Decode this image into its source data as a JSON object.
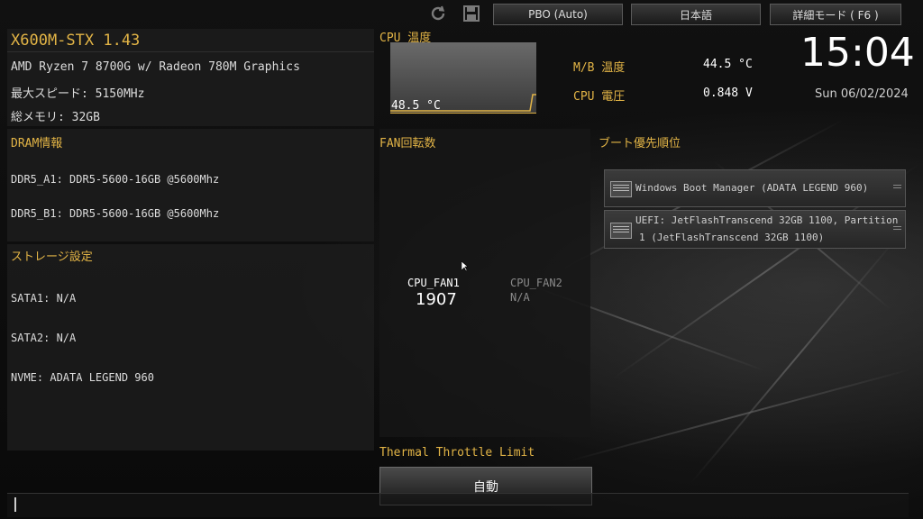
{
  "toolbar": {
    "pbo_label": "PBO (Auto)",
    "language_label": "日本語",
    "advanced_label": "詳細モード ( F6 )"
  },
  "system": {
    "model": "X600M-STX 1.43",
    "cpu": "AMD Ryzen 7 8700G w/ Radeon 780M Graphics",
    "max_speed": "最大スピード: 5150MHz",
    "total_memory": "総メモリ: 32GB"
  },
  "cpu_temp": {
    "title": "CPU 温度",
    "value": "48.5 °C"
  },
  "sensors": {
    "mb_temp_label": "M/B 温度",
    "mb_temp_value": "44.5 °C",
    "cpu_voltage_label": "CPU 電圧",
    "cpu_voltage_value": "0.848 V"
  },
  "clock": {
    "time": "15:04",
    "date": "Sun 06/02/2024"
  },
  "dram": {
    "title": "DRAM情報",
    "slots": [
      "DDR5_A1: DDR5-5600-16GB @5600Mhz",
      "DDR5_B1: DDR5-5600-16GB @5600Mhz"
    ]
  },
  "storage": {
    "title": "ストレージ設定",
    "items": [
      "SATA1: N/A",
      "SATA2: N/A",
      "NVME: ADATA LEGEND 960"
    ]
  },
  "fan": {
    "title": "FAN回転数",
    "fan1_name": "CPU_FAN1",
    "fan1_value": "1907",
    "fan2_name": "CPU_FAN2",
    "fan2_value": "N/A"
  },
  "thermal": {
    "title": "Thermal Throttle Limit",
    "button_label": "自動"
  },
  "boot": {
    "title": "ブート優先順位",
    "item1": "Windows Boot Manager (ADATA LEGEND 960)",
    "item2_line1": "UEFI: JetFlashTranscend 32GB 1100, Partition",
    "item2_line2": "1 (JetFlashTranscend 32GB 1100)"
  },
  "colors": {
    "accent": "#e2b446",
    "text": "#dcdcdc"
  },
  "icons": [
    "refresh-icon",
    "save-icon",
    "disk-icon",
    "drag-handle-icon",
    "mouse-cursor-icon"
  ]
}
